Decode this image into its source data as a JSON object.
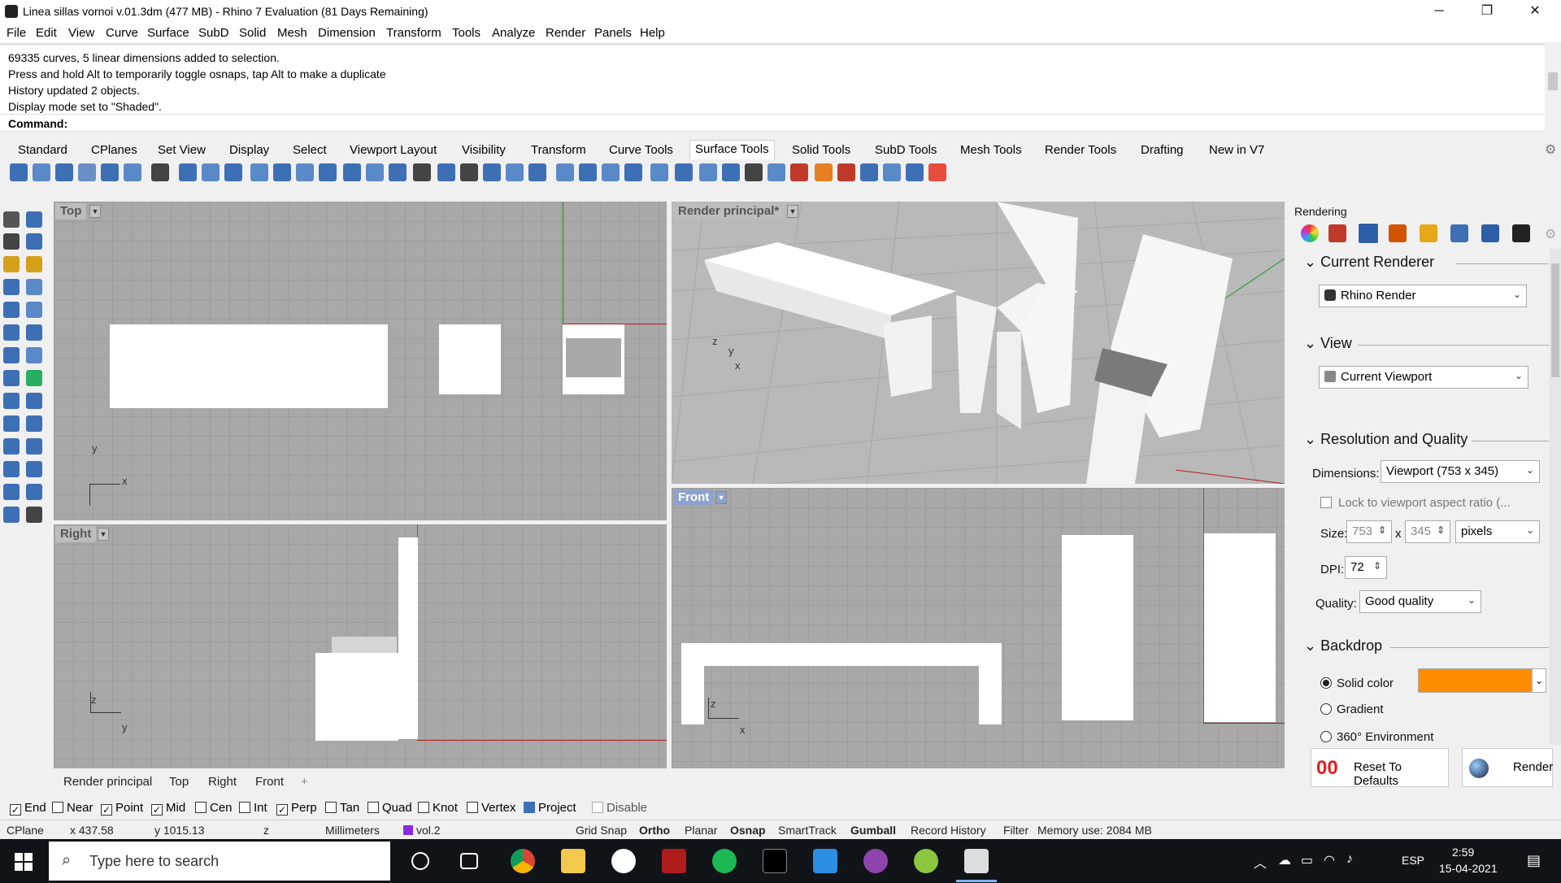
{
  "window": {
    "title": "Linea sillas vornoi v.01.3dm (477 MB) - Rhino 7 Evaluation (81 Days Remaining)",
    "minimize": "─",
    "maximize": "❐",
    "close": "✕"
  },
  "menu": [
    "File",
    "Edit",
    "View",
    "Curve",
    "Surface",
    "SubD",
    "Solid",
    "Mesh",
    "Dimension",
    "Transform",
    "Tools",
    "Analyze",
    "Render",
    "Panels",
    "Help"
  ],
  "command_history": [
    "69335 curves, 5 linear dimensions added to selection.",
    "Press and hold Alt to temporarily toggle osnaps, tap Alt to make a duplicate",
    "History updated 2 objects.",
    "Display mode set to \"Shaded\"."
  ],
  "command_prompt": "Command:",
  "toolbar_tabs": [
    "Standard",
    "CPlanes",
    "Set View",
    "Display",
    "Select",
    "Viewport Layout",
    "Visibility",
    "Transform",
    "Curve Tools",
    "Surface Tools",
    "Solid Tools",
    "SubD Tools",
    "Mesh Tools",
    "Render Tools",
    "Drafting",
    "New in V7"
  ],
  "active_toolbar_tab": "Surface Tools",
  "viewports": {
    "top": {
      "label": "Top",
      "axis_x": "x",
      "axis_y": "y"
    },
    "perspective": {
      "label": "Render principal*",
      "axis_x": "x",
      "axis_y": "y",
      "axis_z": "z"
    },
    "right": {
      "label": "Right",
      "axis_x": "y",
      "axis_y": "z"
    },
    "front": {
      "label": "Front",
      "axis_x": "x",
      "axis_y": "z"
    }
  },
  "viewport_tabs": [
    "Render principal",
    "Top",
    "Right",
    "Front"
  ],
  "viewport_tab_add": "+",
  "osnaps": [
    {
      "label": "End",
      "checked": true
    },
    {
      "label": "Near",
      "checked": false
    },
    {
      "label": "Point",
      "checked": true
    },
    {
      "label": "Mid",
      "checked": true
    },
    {
      "label": "Cen",
      "checked": false
    },
    {
      "label": "Int",
      "checked": false
    },
    {
      "label": "Perp",
      "checked": true
    },
    {
      "label": "Tan",
      "checked": false
    },
    {
      "label": "Quad",
      "checked": false
    },
    {
      "label": "Knot",
      "checked": false
    },
    {
      "label": "Vertex",
      "checked": false
    },
    {
      "label": "Project",
      "checked": true
    },
    {
      "label": "Disable",
      "checked": false
    }
  ],
  "statusbar": {
    "cplane": "CPlane",
    "x": "x 437.58",
    "y": "y 1015.13",
    "z": "z",
    "units": "Millimeters",
    "layer": "vol.2",
    "layer_color": "#8a2be2",
    "grid_snap": "Grid Snap",
    "ortho": "Ortho",
    "planar": "Planar",
    "osnap": "Osnap",
    "smarttrack": "SmartTrack",
    "gumball": "Gumball",
    "record_history": "Record History",
    "filter": "Filter",
    "memory": "Memory use: 2084 MB"
  },
  "rendering_panel": {
    "title": "Rendering",
    "current_renderer": {
      "heading": "Current Renderer",
      "value": "Rhino Render"
    },
    "view": {
      "heading": "View",
      "value": "Current Viewport"
    },
    "resolution": {
      "heading": "Resolution and Quality",
      "dimensions_label": "Dimensions:",
      "dimensions_value": "Viewport (753 x 345)",
      "lock_label": "Lock to viewport aspect ratio (...",
      "size_label": "Size:",
      "width": "753",
      "x": "x",
      "height": "345",
      "unit": "pixels",
      "dpi_label": "DPI:",
      "dpi": "72",
      "quality_label": "Quality:",
      "quality": "Good quality"
    },
    "backdrop": {
      "heading": "Backdrop",
      "solid_color": "Solid color",
      "gradient": "Gradient",
      "environment": "360° Environment",
      "solid_color_value": "#ff8c00"
    },
    "reset_label": "Reset To Defaults",
    "render_label": "Render"
  },
  "taskbar": {
    "search_placeholder": "Type here to search",
    "language": "ESP",
    "time": "2:59",
    "date": "15-04-2021"
  }
}
